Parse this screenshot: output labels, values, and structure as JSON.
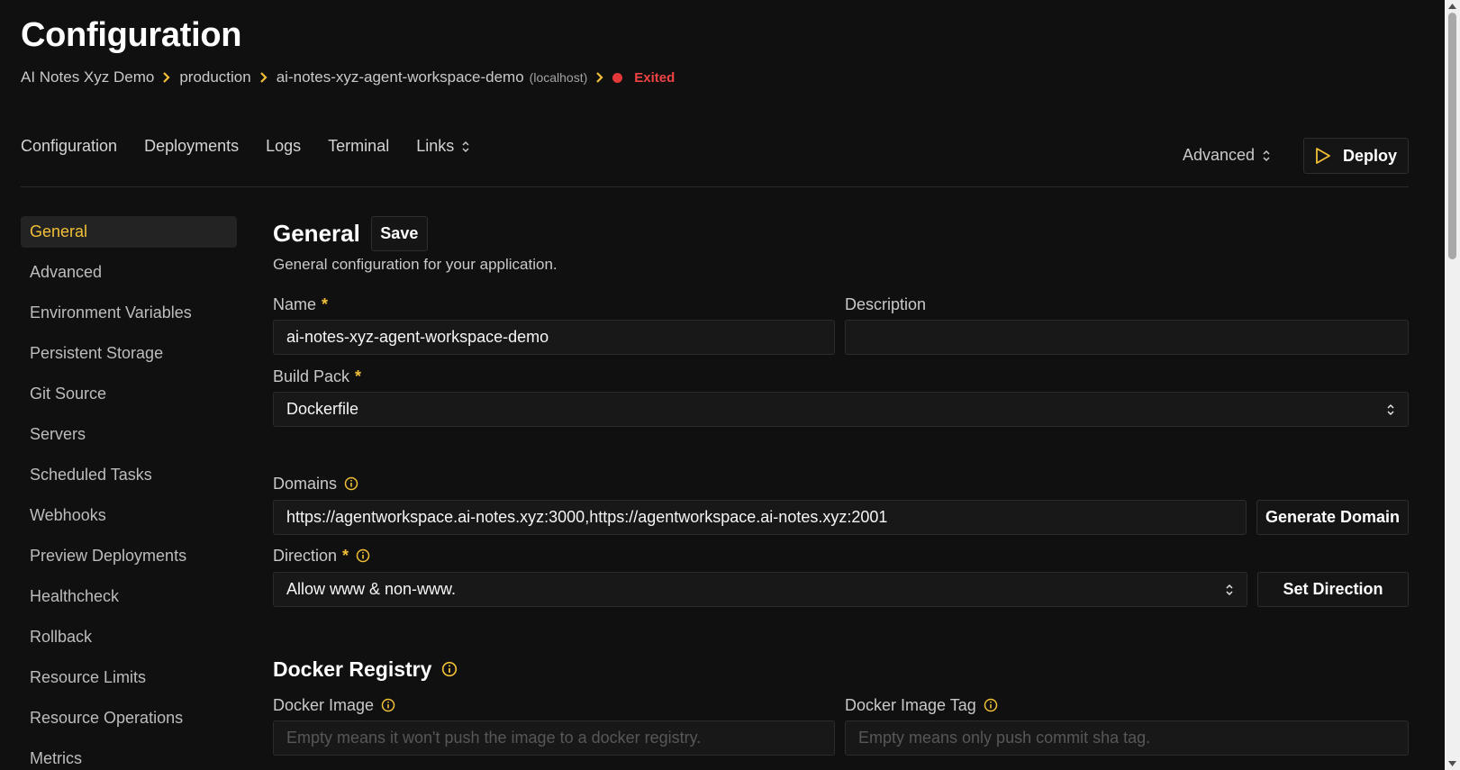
{
  "header": {
    "title": "Configuration",
    "breadcrumb": {
      "project": "AI Notes Xyz Demo",
      "environment": "production",
      "resource": "ai-notes-xyz-agent-workspace-demo",
      "server": "(localhost)",
      "status": "Exited"
    }
  },
  "tabs": {
    "configuration": "Configuration",
    "deployments": "Deployments",
    "logs": "Logs",
    "terminal": "Terminal",
    "links": "Links",
    "advanced": "Advanced",
    "deploy": "Deploy"
  },
  "sidebar": {
    "items": [
      "General",
      "Advanced",
      "Environment Variables",
      "Persistent Storage",
      "Git Source",
      "Servers",
      "Scheduled Tasks",
      "Webhooks",
      "Preview Deployments",
      "Healthcheck",
      "Rollback",
      "Resource Limits",
      "Resource Operations",
      "Metrics"
    ],
    "active": "General"
  },
  "general": {
    "title": "General",
    "save_label": "Save",
    "subtitle": "General configuration for your application.",
    "name_label": "Name",
    "name_value": "ai-notes-xyz-agent-workspace-demo",
    "description_label": "Description",
    "description_value": "",
    "required_marker": "*",
    "build_pack_label": "Build Pack",
    "build_pack_value": "Dockerfile",
    "domains_label": "Domains",
    "domains_value": "https://agentworkspace.ai-notes.xyz:3000,https://agentworkspace.ai-notes.xyz:2001",
    "generate_domain_label": "Generate Domain",
    "direction_label": "Direction",
    "direction_value": "Allow www & non-www.",
    "set_direction_label": "Set Direction"
  },
  "docker_registry": {
    "title": "Docker Registry",
    "image_label": "Docker Image",
    "image_placeholder": "Empty means it won't push the image to a docker registry.",
    "tag_label": "Docker Image Tag",
    "tag_placeholder": "Empty means only push commit sha tag."
  },
  "colors": {
    "accent": "#f2c037",
    "status_exited": "#ef4444",
    "background": "#101010"
  }
}
